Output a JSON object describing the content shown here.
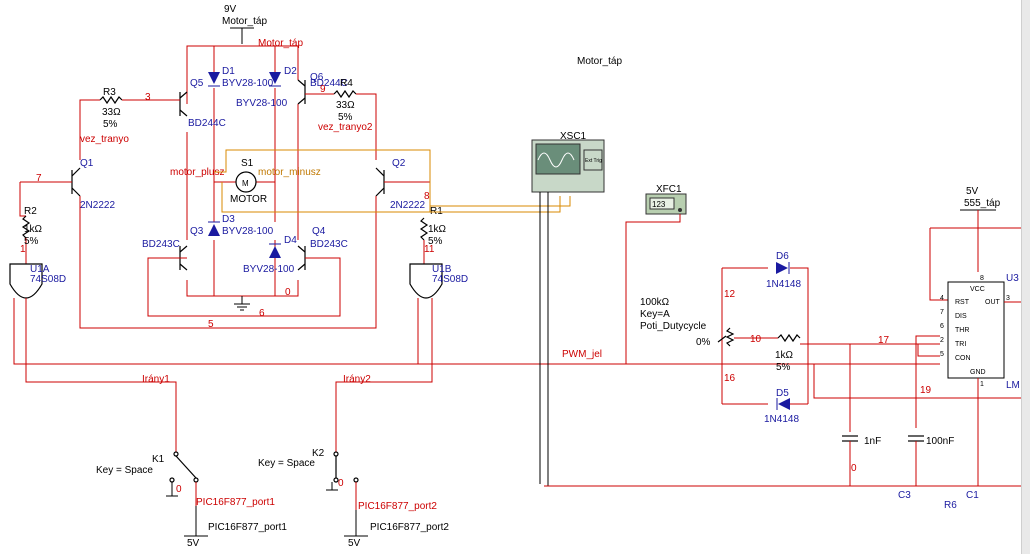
{
  "supplies": {
    "v9": "9V",
    "motor_tap": "Motor_táp",
    "motor_tap_red": "Motor_táp",
    "motor_tap_free": "Motor_táp",
    "v5": "5V",
    "tap555": "555_táp",
    "v5_bottom1": "5V",
    "v5_bottom2": "5V"
  },
  "transistors": {
    "q1": "Q1",
    "q1_type": "2N2222",
    "q2": "Q2",
    "q2_type": "2N2222",
    "q3": "Q3",
    "q3_type": "BD243C",
    "q4": "Q4",
    "q4_type": "BD243C",
    "q5": "Q5",
    "q5_type": "BD244C",
    "q6": "Q6",
    "q6_type": "BD244C"
  },
  "diodes": {
    "d1": "D1",
    "d1_type": "BYV28-100",
    "d2": "D2",
    "d2_type": "BYV28-100",
    "d3": "D3",
    "d3_type": "BYV28-100",
    "d4": "D4",
    "d4_type": "BYV28-100",
    "d5": "D5",
    "d5_type": "1N4148",
    "d6": "D6",
    "d6_type": "1N4148"
  },
  "resistors": {
    "r1": "R1",
    "r1_val": "1kΩ",
    "r1_tol": "5%",
    "r2": "R2",
    "r2_val": "1kΩ",
    "r2_tol": "5%",
    "r3": "R3",
    "r3_val": "33Ω",
    "r3_tol": "5%",
    "r4": "R4",
    "r4_val": "33Ω",
    "r4_tol": "5%",
    "r5_val": "1kΩ",
    "r5_tol": "5%",
    "r6": "R6"
  },
  "pot": {
    "val": "100kΩ",
    "key": "Key=A",
    "name": "Poti_Dutycycle",
    "pct": "0%"
  },
  "gates": {
    "u1a": "U1A",
    "u1a_type": "74S08D",
    "u1b": "U1B",
    "u1b_type": "74S08D"
  },
  "motor": {
    "s1": "S1",
    "label": "MOTOR",
    "plusz": "motor_plusz",
    "minusz": "motor_minusz"
  },
  "nets": {
    "n3": "3",
    "n9": "9",
    "n7": "7",
    "n8": "8",
    "n5": "5",
    "n6": "6",
    "n0": "0",
    "n11": "11",
    "n1": "1",
    "n12": "12",
    "n10": "10",
    "n16": "16",
    "n17": "17",
    "n19": "19",
    "n0b": "0",
    "vez_tranyo": "vez_tranyo",
    "vez_tranyo2": "vez_tranyo2",
    "pwm": "PWM_jel",
    "irany1": "Irány1",
    "irany2": "Irány2"
  },
  "instruments": {
    "xsc1": "XSC1",
    "xfc1": "XFC1",
    "xfc_display": "123",
    "ext_trig": "Ext Trig"
  },
  "switches": {
    "k1": "K1",
    "k1_key": "Key = Space",
    "k2": "K2",
    "k2_key": "Key = Space",
    "port1_red": "PIC16F877_port1",
    "port1": "PIC16F877_port1",
    "port2_red": "PIC16F877_port2",
    "port2": "PIC16F877_port2",
    "k1_zero": "0",
    "k2_zero": "0"
  },
  "capacitors": {
    "c1": "C1",
    "c1_val": "1nF",
    "c3": "C3",
    "c3_val": "100nF"
  },
  "timer": {
    "u3": "U3",
    "lm": "LM",
    "vcc": "VCC",
    "rst": "RST",
    "dis": "DIS",
    "thr": "THR",
    "tri": "TRI",
    "con": "CON",
    "gnd": "GND",
    "out": "OUT",
    "p4": "4",
    "p7": "7",
    "p6": "6",
    "p2": "2",
    "p5": "5",
    "p8": "8",
    "p1": "1",
    "p3": "3"
  },
  "colors": {
    "wire_red": "#cc0000",
    "wire_orange": "#d98a00",
    "label_blue": "#1a1aa0",
    "scope": "#6a8e7a",
    "counter": "#b8cfb0"
  }
}
